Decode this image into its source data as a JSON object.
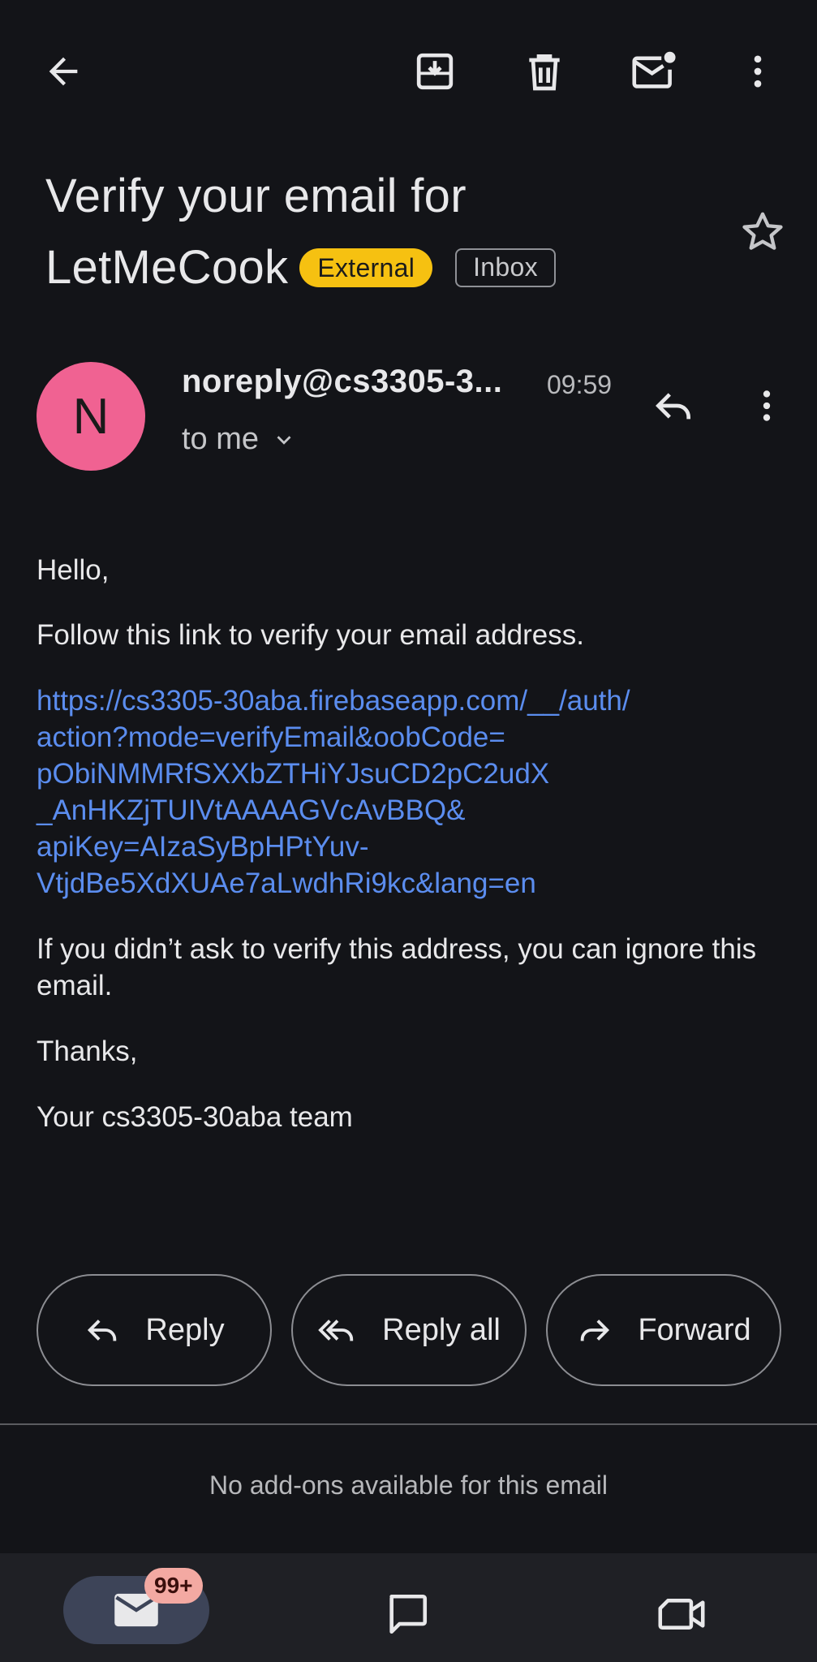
{
  "toolbar": {
    "back_icon": "arrow-back-icon",
    "archive_icon": "archive-icon",
    "delete_icon": "trash-icon",
    "mark_unread_icon": "mark-unread-icon",
    "more_icon": "more-vert-icon"
  },
  "email": {
    "subject_line1": "Verify your email for",
    "subject_line2": "LetMeCook",
    "label_external": "External",
    "label_inbox": "Inbox",
    "sender_initial": "N",
    "sender_name": "noreply@cs3305-3...",
    "time": "09:59",
    "recipient": "to me",
    "body": {
      "greeting": "Hello,",
      "instruction": "Follow this link to verify your email address.",
      "link_lines": [
        "https://cs3305-30aba.firebaseapp.com/__/auth/",
        "action?mode=verifyEmail&oobCode=",
        "pObiNMMRfSXXbZTHiYJsuCD2pC2udX",
        "_AnHKZjTUIVtAAAAGVcAvBBQ&",
        "apiKey=AIzaSyBpHPtYuv-",
        "VtjdBe5XdXUAe7aLwdhRi9kc&lang=en"
      ],
      "ignore_note": "If you didn’t ask to verify this address, you can ignore this email.",
      "thanks": "Thanks,",
      "signature": "Your cs3305-30aba team"
    }
  },
  "actions": {
    "reply": "Reply",
    "reply_all": "Reply all",
    "forward": "Forward"
  },
  "addons_text": "No add-ons available for this email",
  "bottom_nav": {
    "mail_badge": "99+"
  },
  "colors": {
    "background": "#131418",
    "link": "#5b8def",
    "external_chip": "#f6c111",
    "avatar": "#f06292",
    "badge": "#f3a9a2"
  }
}
